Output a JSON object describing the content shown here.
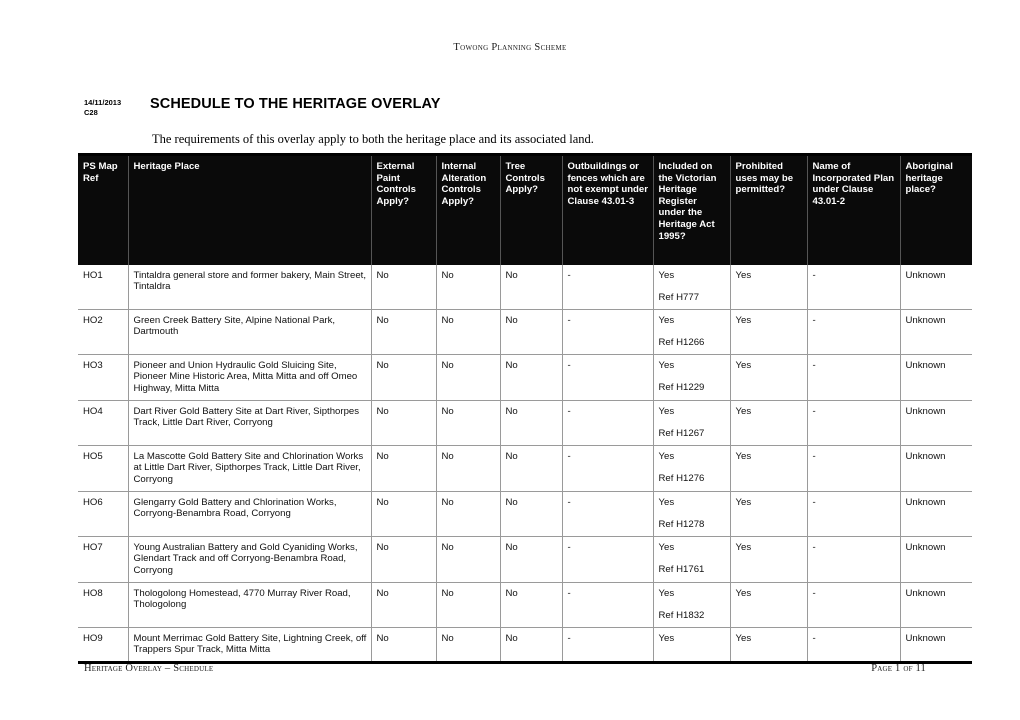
{
  "running_head": "Towong Planning Scheme",
  "title_block": {
    "amendment_date": "14/11/2013",
    "amendment_version": "C28",
    "title": "SCHEDULE TO THE HERITAGE OVERLAY"
  },
  "intro": "The requirements of this overlay apply to both the heritage place and its associated land.",
  "table": {
    "headers": [
      "PS Map Ref",
      "Heritage Place",
      "External Paint Controls Apply?",
      "Internal Alteration Controls Apply?",
      "Tree Controls Apply?",
      "Outbuildings or fences which are not exempt under Clause 43.01-3",
      "Included on the Victorian Heritage Register under the Heritage Act 1995?",
      "Prohibited uses may be permitted?",
      "Name of Incorporated Plan under Clause 43.01-2",
      "Aboriginal heritage place?"
    ],
    "rows": [
      {
        "map_ref": "HO1",
        "place": "Tintaldra general store and former bakery, Main Street, Tintaldra",
        "external_paint": "No",
        "internal_alteration": "No",
        "tree_controls": "No",
        "outbuildings": "-",
        "vhr": "Yes",
        "vhr_ref": "Ref H777",
        "prohibited_uses": "Yes",
        "incorporated_plan": "-",
        "aboriginal": "Unknown"
      },
      {
        "map_ref": "HO2",
        "place": "Green Creek Battery Site, Alpine National Park, Dartmouth",
        "external_paint": "No",
        "internal_alteration": "No",
        "tree_controls": "No",
        "outbuildings": "-",
        "vhr": "Yes",
        "vhr_ref": "Ref H1266",
        "prohibited_uses": "Yes",
        "incorporated_plan": "-",
        "aboriginal": "Unknown"
      },
      {
        "map_ref": "HO3",
        "place": "Pioneer and Union Hydraulic Gold Sluicing Site, Pioneer Mine Historic Area, Mitta Mitta and off Omeo Highway, Mitta Mitta",
        "external_paint": "No",
        "internal_alteration": "No",
        "tree_controls": "No",
        "outbuildings": "-",
        "vhr": "Yes",
        "vhr_ref": "Ref H1229",
        "prohibited_uses": "Yes",
        "incorporated_plan": "-",
        "aboriginal": "Unknown"
      },
      {
        "map_ref": "HO4",
        "place": "Dart River Gold Battery Site at Dart River, Sipthorpes Track, Little Dart River, Corryong",
        "external_paint": "No",
        "internal_alteration": "No",
        "tree_controls": "No",
        "outbuildings": "-",
        "vhr": "Yes",
        "vhr_ref": "Ref H1267",
        "prohibited_uses": "Yes",
        "incorporated_plan": "-",
        "aboriginal": "Unknown"
      },
      {
        "map_ref": "HO5",
        "place": "La Mascotte Gold Battery Site and Chlorination Works at Little Dart River, Sipthorpes Track, Little Dart River, Corryong",
        "external_paint": "No",
        "internal_alteration": "No",
        "tree_controls": "No",
        "outbuildings": "-",
        "vhr": "Yes",
        "vhr_ref": "Ref H1276",
        "prohibited_uses": "Yes",
        "incorporated_plan": "-",
        "aboriginal": "Unknown"
      },
      {
        "map_ref": "HO6",
        "place": "Glengarry Gold Battery and Chlorination Works, Corryong-Benambra Road, Corryong",
        "external_paint": "No",
        "internal_alteration": "No",
        "tree_controls": "No",
        "outbuildings": "-",
        "vhr": "Yes",
        "vhr_ref": "Ref H1278",
        "prohibited_uses": "Yes",
        "incorporated_plan": "-",
        "aboriginal": "Unknown"
      },
      {
        "map_ref": "HO7",
        "place": "Young Australian Battery and Gold Cyaniding Works, Glendart Track and off Corryong-Benambra Road, Corryong",
        "external_paint": "No",
        "internal_alteration": "No",
        "tree_controls": "No",
        "outbuildings": "-",
        "vhr": "Yes",
        "vhr_ref": "Ref H1761",
        "prohibited_uses": "Yes",
        "incorporated_plan": "-",
        "aboriginal": "Unknown"
      },
      {
        "map_ref": "HO8",
        "place": "Thologolong Homestead, 4770 Murray River Road, Thologolong",
        "external_paint": "No",
        "internal_alteration": "No",
        "tree_controls": "No",
        "outbuildings": "-",
        "vhr": "Yes",
        "vhr_ref": "Ref H1832",
        "prohibited_uses": "Yes",
        "incorporated_plan": "-",
        "aboriginal": "Unknown"
      },
      {
        "map_ref": "HO9",
        "place": "Mount Merrimac Gold Battery Site, Lightning Creek, off Trappers Spur Track, Mitta Mitta",
        "external_paint": "No",
        "internal_alteration": "No",
        "tree_controls": "No",
        "outbuildings": "-",
        "vhr": "Yes",
        "vhr_ref": "",
        "prohibited_uses": "Yes",
        "incorporated_plan": "-",
        "aboriginal": "Unknown"
      }
    ]
  },
  "footer": {
    "left": "Heritage Overlay – Schedule",
    "right": "Page 1 of 11"
  }
}
